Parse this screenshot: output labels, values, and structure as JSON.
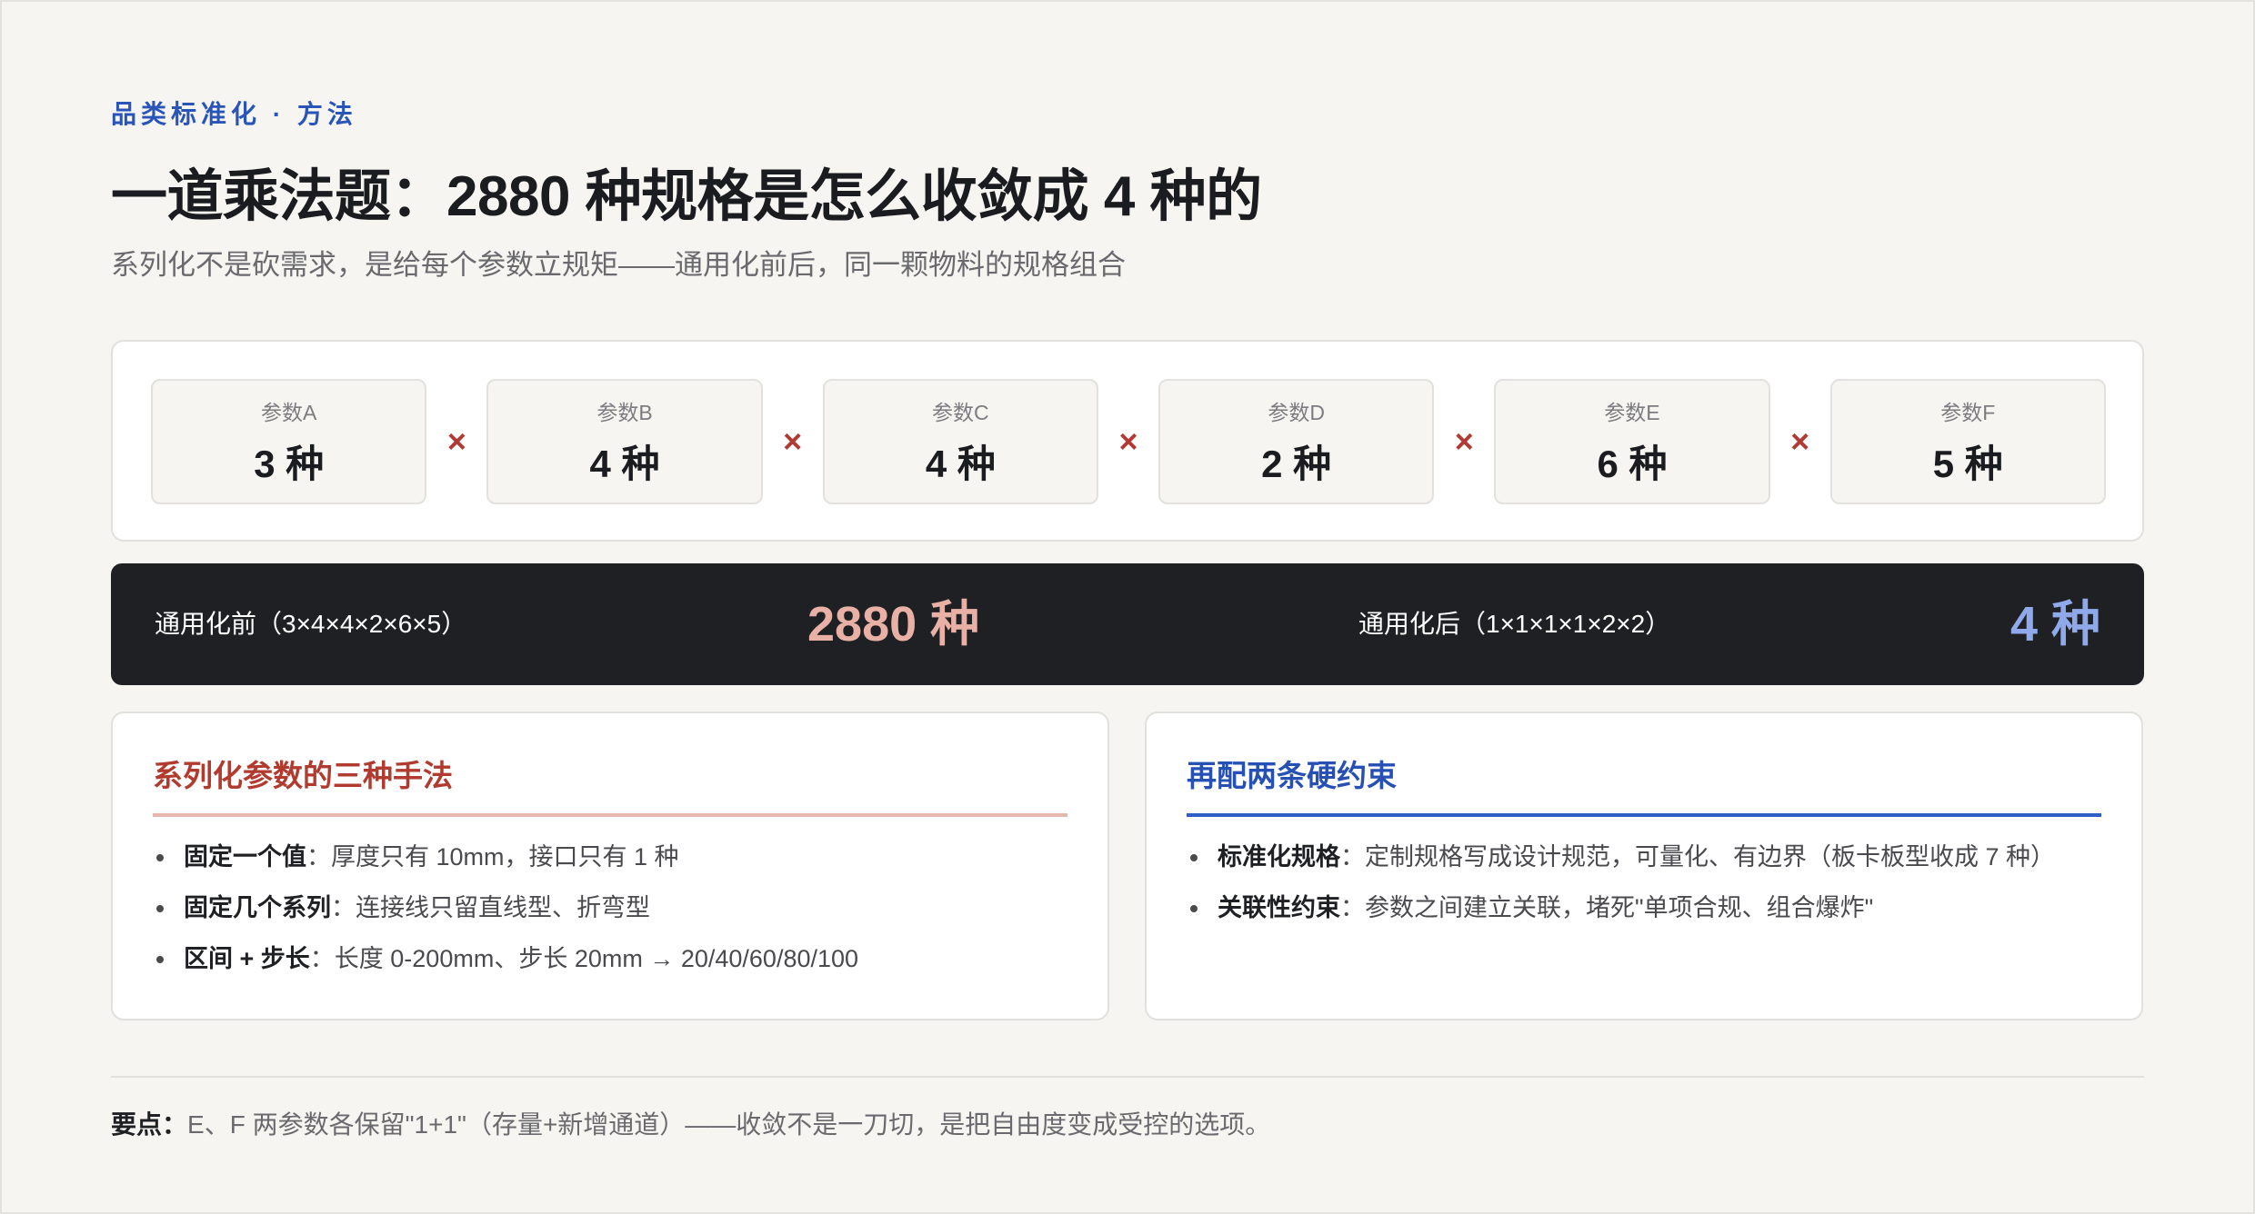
{
  "header": {
    "eyebrow": "品类标准化 · 方法",
    "title": "一道乘法题：2880 种规格是怎么收敛成 4 种的",
    "subtitle": "系列化不是砍需求，是给每个参数立规矩——通用化前后，同一颗物料的规格组合"
  },
  "params": [
    {
      "label": "参数A",
      "value": "3 种"
    },
    {
      "label": "参数B",
      "value": "4 种"
    },
    {
      "label": "参数C",
      "value": "4 种"
    },
    {
      "label": "参数D",
      "value": "2 种"
    },
    {
      "label": "参数E",
      "value": "6 种"
    },
    {
      "label": "参数F",
      "value": "5 种"
    }
  ],
  "times_symbol": "×",
  "result": {
    "before_label": "通用化前（3×4×4×2×6×5）",
    "before_value": "2880 种",
    "after_label": "通用化后（1×1×1×1×2×2）",
    "after_value": "4 种"
  },
  "card_left": {
    "title": "系列化参数的三种手法",
    "items": [
      {
        "term": "固定一个值",
        "text": "：厚度只有 10mm，接口只有 1 种"
      },
      {
        "term": "固定几个系列",
        "text": "：连接线只留直线型、折弯型"
      },
      {
        "term": "区间 + 步长",
        "text": "：长度 0-200mm、步长 20mm → 20/40/60/80/100"
      }
    ]
  },
  "card_right": {
    "title": "再配两条硬约束",
    "items": [
      {
        "term": "标准化规格",
        "text": "：定制规格写成设计规范，可量化、有边界（板卡板型收成 7 种）"
      },
      {
        "term": "关联性约束",
        "text": "：参数之间建立关联，堵死\"单项合规、组合爆炸\""
      }
    ]
  },
  "footnote": {
    "label": "要点：",
    "text": "E、F 两参数各保留\"1+1\"（存量+新增通道）——收敛不是一刀切，是把自由度变成受控的选项。"
  },
  "colors": {
    "accent_blue": "#2a55b8",
    "accent_red": "#b23b30",
    "before_value": "#e9b1a6",
    "after_value": "#8fa9ea",
    "dark_bar": "#1f2023"
  }
}
